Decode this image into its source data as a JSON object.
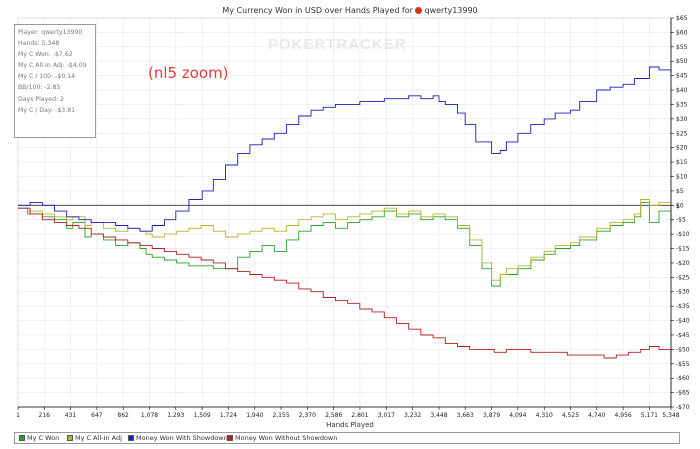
{
  "chart_data": {
    "type": "line",
    "title": "My Currency Won in USD over Hands Played for",
    "player": "qwerty13990",
    "xlabel": "Hands Played",
    "ylabel": "$",
    "xlim": [
      1,
      5348
    ],
    "ylim": [
      -70,
      65
    ],
    "x_ticks": [
      "1",
      "216",
      "431",
      "647",
      "862",
      "1,078",
      "1,293",
      "1,509",
      "1,724",
      "1,940",
      "2,155",
      "2,370",
      "2,586",
      "2,801",
      "3,017",
      "3,232",
      "3,448",
      "3,663",
      "3,879",
      "4,094",
      "4,310",
      "4,525",
      "4,740",
      "4,956",
      "5,171",
      "5,348"
    ],
    "y_ticks": [
      "$65",
      "$60",
      "$55",
      "$50",
      "$45",
      "$40",
      "$35",
      "$30",
      "$25",
      "$20",
      "$15",
      "$10",
      "$5",
      "$0",
      "-$5",
      "-$10",
      "-$15",
      "-$20",
      "-$25",
      "-$30",
      "-$35",
      "-$40",
      "-$45",
      "-$50",
      "-$55",
      "-$60",
      "-$65",
      "-$70"
    ],
    "grid": true,
    "legend_position": "bottom",
    "series": [
      {
        "name": "My C Won",
        "color": "#2ca02c",
        "x": [
          1,
          80,
          200,
          300,
          400,
          450,
          550,
          600,
          700,
          800,
          900,
          1000,
          1050,
          1100,
          1200,
          1300,
          1400,
          1500,
          1600,
          1700,
          1800,
          1900,
          2000,
          2100,
          2200,
          2300,
          2400,
          2500,
          2600,
          2700,
          2800,
          2900,
          3000,
          3100,
          3200,
          3300,
          3400,
          3500,
          3600,
          3700,
          3800,
          3879,
          3950,
          4000,
          4094,
          4200,
          4310,
          4400,
          4525,
          4600,
          4740,
          4850,
          4956,
          5050,
          5100,
          5171,
          5250,
          5348
        ],
        "values": [
          -1,
          -3,
          -4,
          -5,
          -8,
          -6,
          -11,
          -10,
          -12,
          -14,
          -13,
          -15,
          -17,
          -18,
          -19,
          -20,
          -21,
          -21,
          -22,
          -22,
          -18,
          -16,
          -14,
          -16,
          -12,
          -9,
          -7,
          -6,
          -8,
          -6,
          -5,
          -4,
          -2,
          -4,
          -3,
          -5,
          -4,
          -5,
          -8,
          -14,
          -22,
          -28,
          -24,
          -24,
          -22,
          -19,
          -17,
          -15,
          -14,
          -12,
          -9,
          -7,
          -6,
          -4,
          1,
          -6,
          -2,
          -7
        ]
      },
      {
        "name": "My C All-In Adj",
        "color": "#b5b52a",
        "x": [
          1,
          80,
          200,
          300,
          400,
          450,
          550,
          600,
          700,
          800,
          900,
          1000,
          1050,
          1100,
          1200,
          1300,
          1400,
          1500,
          1600,
          1700,
          1800,
          1900,
          2000,
          2100,
          2200,
          2300,
          2400,
          2500,
          2600,
          2700,
          2800,
          2900,
          3000,
          3100,
          3200,
          3300,
          3400,
          3500,
          3600,
          3700,
          3800,
          3879,
          3950,
          4000,
          4094,
          4200,
          4310,
          4400,
          4525,
          4600,
          4740,
          4850,
          4956,
          5050,
          5100,
          5171,
          5250,
          5348
        ],
        "values": [
          -1,
          -2,
          -3,
          -4,
          -5,
          -4,
          -7,
          -6,
          -8,
          -9,
          -8,
          -9,
          -10,
          -11,
          -10,
          -9,
          -8,
          -7,
          -9,
          -11,
          -10,
          -9,
          -8,
          -9,
          -7,
          -5,
          -4,
          -3,
          -5,
          -4,
          -3,
          -2,
          -1,
          -3,
          -2,
          -4,
          -3,
          -4,
          -7,
          -12,
          -20,
          -26,
          -24,
          -22,
          -21,
          -18,
          -16,
          -14,
          -13,
          -11,
          -8,
          -6,
          -5,
          -3,
          2,
          0,
          1,
          -3
        ]
      },
      {
        "name": "Money Won With Showdown",
        "color": "#1c1cb8",
        "x": [
          1,
          100,
          200,
          300,
          400,
          500,
          600,
          700,
          800,
          900,
          1000,
          1100,
          1200,
          1293,
          1400,
          1509,
          1600,
          1700,
          1800,
          1900,
          2000,
          2100,
          2200,
          2300,
          2400,
          2500,
          2600,
          2700,
          2800,
          2900,
          3000,
          3100,
          3200,
          3300,
          3400,
          3448,
          3500,
          3600,
          3663,
          3750,
          3879,
          3950,
          4000,
          4094,
          4200,
          4310,
          4400,
          4525,
          4600,
          4740,
          4850,
          4956,
          5050,
          5171,
          5250,
          5348
        ],
        "values": [
          0,
          1,
          0,
          -2,
          -4,
          -5,
          -6,
          -6,
          -7,
          -8,
          -9,
          -7,
          -5,
          -2,
          2,
          5,
          9,
          14,
          18,
          21,
          23,
          25,
          28,
          31,
          33,
          34,
          35,
          35,
          36,
          36,
          37,
          37,
          38,
          37,
          38,
          36,
          35,
          32,
          28,
          22,
          18,
          19,
          22,
          25,
          28,
          30,
          32,
          33,
          36,
          40,
          41,
          42,
          44,
          48,
          47,
          46
        ]
      },
      {
        "name": "Money Won Without Showdown",
        "color": "#b02020",
        "x": [
          1,
          100,
          200,
          300,
          400,
          500,
          600,
          700,
          800,
          900,
          1000,
          1100,
          1200,
          1300,
          1400,
          1500,
          1600,
          1700,
          1800,
          1900,
          2000,
          2100,
          2200,
          2300,
          2400,
          2500,
          2600,
          2700,
          2800,
          2900,
          3000,
          3100,
          3200,
          3300,
          3400,
          3500,
          3600,
          3700,
          3800,
          3900,
          4000,
          4100,
          4200,
          4300,
          4400,
          4500,
          4600,
          4700,
          4800,
          4900,
          5000,
          5100,
          5171,
          5250,
          5348
        ],
        "values": [
          -1,
          -3,
          -5,
          -6,
          -7,
          -8,
          -10,
          -11,
          -12,
          -13,
          -14,
          -15,
          -16,
          -17,
          -18,
          -19,
          -20,
          -22,
          -23,
          -24,
          -25,
          -26,
          -27,
          -29,
          -30,
          -32,
          -33,
          -34,
          -36,
          -37,
          -39,
          -41,
          -43,
          -45,
          -46,
          -48,
          -49,
          -50,
          -50,
          -51,
          -50,
          -50,
          -51,
          -51,
          -51,
          -52,
          -52,
          -52,
          -53,
          -52,
          -51,
          -50,
          -49,
          -50,
          -54
        ]
      }
    ]
  },
  "stats_box": [
    "Player: qwerty13990",
    "Hands: 5,348",
    "My C Won: -$7.62",
    "My C All-In Adj: -$4.09",
    "My C / 100: -$0.14",
    "BB/100: -2.85",
    "Days Played: 2",
    "My C / Day: -$3.81"
  ],
  "annotation": "(nl5 zoom)",
  "watermark": "POKERTRACKER",
  "colors": {
    "background": "#ffffff",
    "grid": "#e6e6e6",
    "axis": "#000000",
    "zero_line": "#333333"
  }
}
